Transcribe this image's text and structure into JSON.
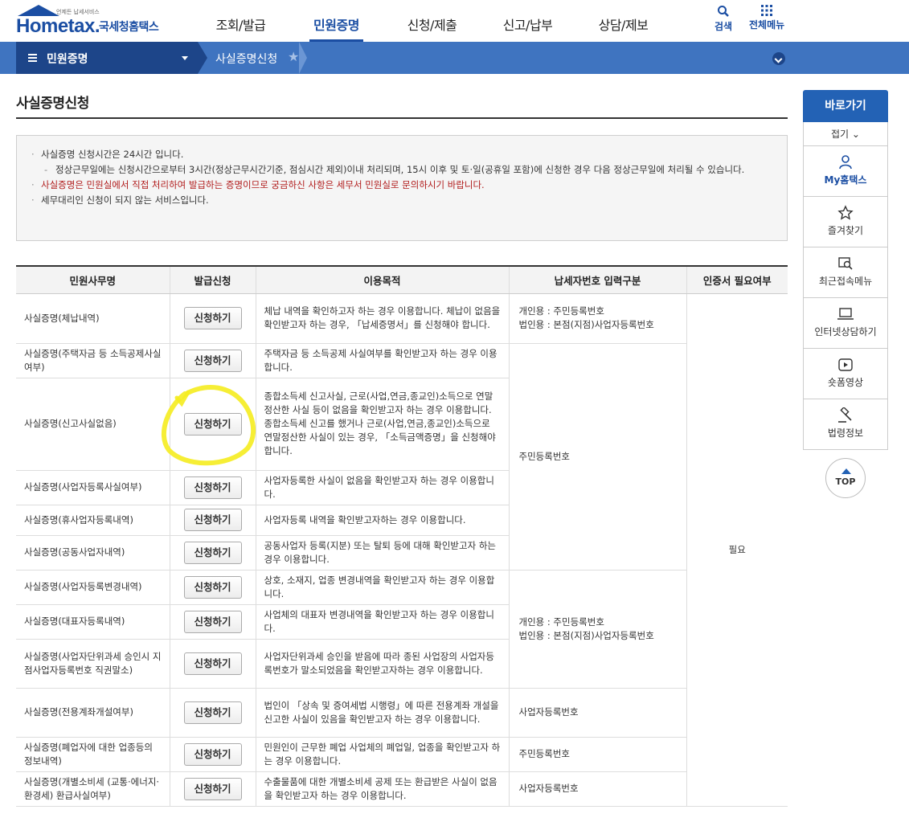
{
  "header": {
    "logo_main": "Hometax.",
    "logo_sub": "국세청홈택스",
    "logo_small": "언제든 납세서비스",
    "nav": [
      "조회/발급",
      "민원증명",
      "신청/제출",
      "신고/납부",
      "상담/제보"
    ],
    "active_nav": "민원증명",
    "search_label": "검색",
    "all_menu_label": "전체메뉴"
  },
  "bar": {
    "menu_label": "민원증명",
    "breadcrumb": "사실증명신청"
  },
  "page": {
    "title": "사실증명신청"
  },
  "notice": {
    "line1": "사실증명 신청시간은 24시간 입니다.",
    "line2": "정상근무일에는 신청시간으로부터 3시간(정상근무시간기준, 점심시간 제외)이내 처리되며, 15시 이후 및 토·일(공휴일 포함)에 신청한 경우 다음 정상근무일에 처리될 수 있습니다.",
    "line3": "사실증명은 민원실에서 직접 처리하여 발급하는 증명이므로 궁금하신 사항은 세무서 민원실로 문의하시기 바랍니다.",
    "line4": "세무대리인 신청이 되지 않는 서비스입니다."
  },
  "table": {
    "headers": [
      "민원사무명",
      "발급신청",
      "이용목적",
      "납세자번호 입력구분",
      "인증서 필요여부"
    ],
    "button_label": "신청하기",
    "cert_value": "필요",
    "input_types": {
      "type_a_line1": "개인용 : 주민등록번호",
      "type_a_line2": "법인용 : 본점(지점)사업자등록번호",
      "resident": "주민등록번호",
      "business": "사업자등록번호"
    },
    "rows": [
      {
        "name": "사실증명(체납내역)",
        "purpose": "체납 내역을 확인하고자 하는 경우 이용합니다. 체납이 없음을 확인받고자 하는 경우, 「납세증명서」를 신청해야 합니다."
      },
      {
        "name": "사실증명(주택자금 등 소득공제사실여부)",
        "purpose": "주택자금 등 소득공제 사실여부를 확인받고자 하는 경우 이용합니다."
      },
      {
        "name": "사실증명(신고사실없음)",
        "purpose": "종합소득세 신고사실, 근로(사업,연금,종교인)소득으로 연말정산한 사실 등이 없음을 확인받고자 하는 경우 이용합니다. 종합소득세 신고를 했거나 근로(사업,연금,종교인)소득으로 연말정산한 사실이 있는 경우, 「소득금액증명」을 신청해야 합니다."
      },
      {
        "name": "사실증명(사업자등록사실여부)",
        "purpose": "사업자등록한 사실이 없음을 확인받고자 하는 경우 이용합니다."
      },
      {
        "name": "사실증명(휴사업자등록내역)",
        "purpose": "사업자등록 내역을 확인받고자하는 경우 이용합니다."
      },
      {
        "name": "사실증명(공동사업자내역)",
        "purpose": "공동사업자 등록(지분) 또는 탈퇴 등에 대해 확인받고자 하는 경우 이용합니다."
      },
      {
        "name": "사실증명(사업자등록변경내역)",
        "purpose": "상호, 소재지, 업종 변경내역을 확인받고자 하는 경우 이용합니다."
      },
      {
        "name": "사실증명(대표자등록내역)",
        "purpose": "사업체의 대표자 변경내역을 확인받고자 하는 경우 이용합니다."
      },
      {
        "name": "사실증명(사업자단위과세 승인시 지점사업자등록번호 직권말소)",
        "purpose": "사업자단위과세 승인을 받음에 따라 종된 사업장의 사업자등록번호가 말소되었음을 확인받고자하는 경우 이용합니다."
      },
      {
        "name": "사실증명(전용계좌개설여부)",
        "purpose": "법인이 「상속 및 증여세법 시행령」에 따른 전용계좌 개설을 신고한 사실이 있음을 확인받고자 하는 경우 이용합니다."
      },
      {
        "name": "사실증명(폐업자에 대한 업종등의 정보내역)",
        "purpose": "민원인이 근무한 폐업 사업체의 폐업일, 업종을 확인받고자 하는 경우 이용합니다."
      },
      {
        "name": "사실증명(개별소비세 (교통·에너지·환경세) 환급사실여부)",
        "purpose": "수출물품에 대한 개별소비세 공제 또는 환급받은 사실이 없음을 확인받고자 하는 경우 이용합니다."
      }
    ]
  },
  "quick": {
    "title": "바로가기",
    "fold": "접기",
    "items": [
      "My홈택스",
      "즐겨찾기",
      "최근접속메뉴",
      "인터넷상담하기",
      "숏폼영상",
      "법령정보"
    ],
    "top": "TOP"
  },
  "colors": {
    "brand": "#1b4ea3",
    "bar": "#3f74c0",
    "bar_dark": "#1d4589",
    "highlight": "#f5ec1f",
    "notice_red": "#b11c1c"
  }
}
